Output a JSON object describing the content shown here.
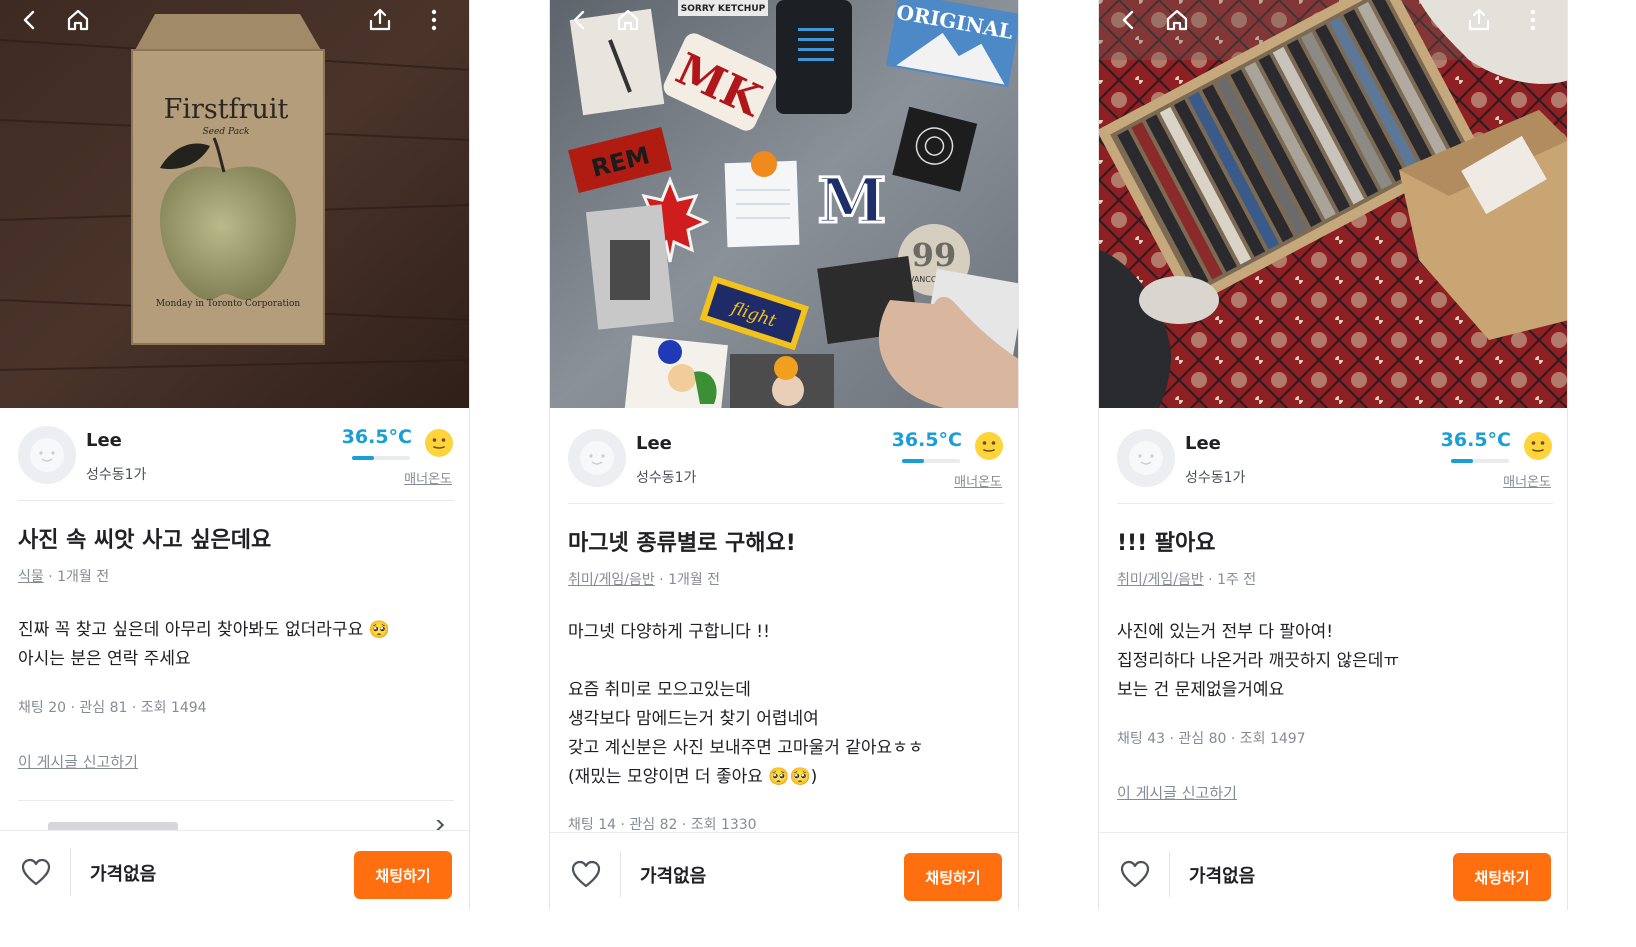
{
  "icons": {
    "back": "back-arrow-icon",
    "home": "home-icon",
    "share": "share-icon",
    "more": "more-vertical-icon",
    "avatar": "avatar-placeholder",
    "manner_face": "smiley-face-icon",
    "like": "heart-icon"
  },
  "colors": {
    "brand": "#ff6f0f",
    "temperature": "#1a9ed6",
    "text_primary": "#212124",
    "text_secondary": "#868b94"
  },
  "screens": [
    {
      "seller": {
        "name": "Lee",
        "region": "성수동1가",
        "temperature": "36.5°C",
        "temperature_level": 0.38,
        "manner_label": "매너온도"
      },
      "title": "사진 속 씨앗 사고 싶은데요",
      "meta": {
        "category": "식물",
        "time": " · 1개월 전"
      },
      "body": [
        "진짜 꼭 찾고 싶은데 아무리 찾아봐도 없더라구요 🥺",
        "아시는 분은 연락 주세요"
      ],
      "stats": "채팅 20 · 관심 81 · 조회 1494",
      "report": "이 게시글 신고하기",
      "bottom": {
        "price": "가격없음",
        "chat_button": "채팅하기"
      }
    },
    {
      "seller": {
        "name": "Lee",
        "region": "성수동1가",
        "temperature": "36.5°C",
        "temperature_level": 0.38,
        "manner_label": "매너온도"
      },
      "title": "마그넷 종류별로 구해요!",
      "meta": {
        "category": "취미/게임/음반",
        "time": " · 1개월 전"
      },
      "body": [
        "마그넷 다양하게 구합니다 !!",
        "",
        "요즘 취미로 모으고있는데",
        "생각보다 맘에드는거 찾기 어렵네여",
        "갖고 계신분은 사진 보내주면 고마울거 같아요ㅎㅎ",
        "(재밌는 모양이면 더 좋아요 🥺🥺)"
      ],
      "stats": "채팅 14 · 관심 82 · 조회 1330",
      "report": "",
      "bottom": {
        "price": "가격없음",
        "chat_button": "채팅하기"
      }
    },
    {
      "seller": {
        "name": "Lee",
        "region": "성수동1가",
        "temperature": "36.5°C",
        "temperature_level": 0.38,
        "manner_label": "매너온도"
      },
      "title": "!!! 팔아요",
      "meta": {
        "category": "취미/게임/음반",
        "time": " · 1주 전"
      },
      "body": [
        "사진에 있는거 전부 다 팔아여!",
        "집정리하다 나온거라 깨끗하지 않은데ㅠ",
        "보는 건 문제없을거예요"
      ],
      "stats": "채팅 43 · 관심 80 · 조회 1497",
      "report": "이 게시글 신고하기",
      "bottom": {
        "price": "가격없음",
        "chat_button": "채팅하기"
      }
    }
  ],
  "photo_text": {
    "seed_brand": "Firstfruit",
    "seed_sub": "Seed Pack",
    "seed_maker": "Monday in Toronto Corporation",
    "magnet_original": "ORIGINAL",
    "magnet_mk": "MK",
    "magnet_m": "M",
    "magnet_rem": "REM",
    "magnet_99": "99",
    "magnet_vancouver": "VANCOUVER",
    "magnet_sorry": "SORRY KETCHUP",
    "magnet_flight": "flight"
  }
}
